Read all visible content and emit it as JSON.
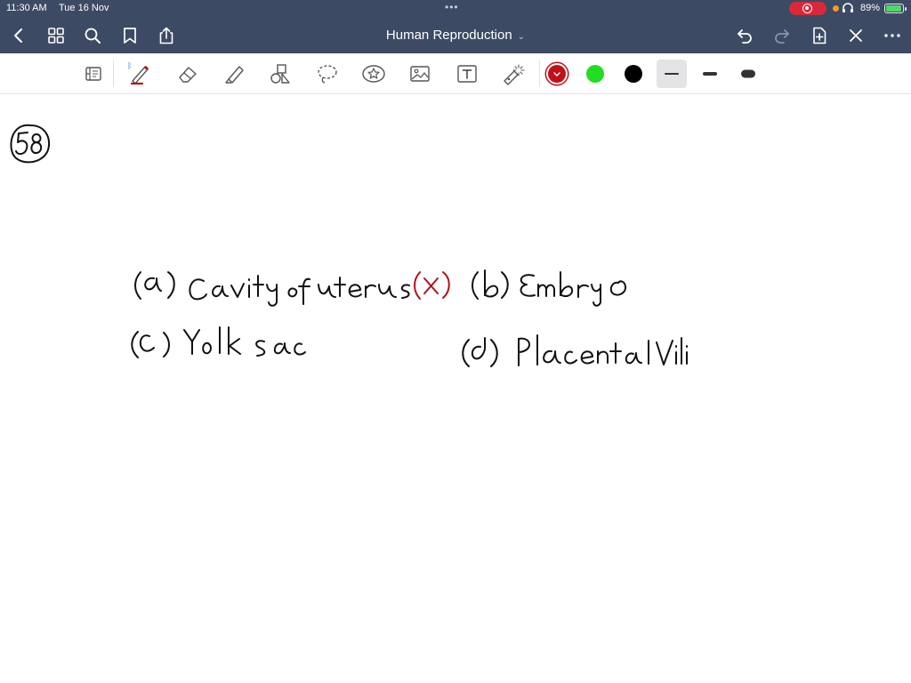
{
  "status_bar": {
    "time": "11:30 AM",
    "date": "Tue 16 Nov",
    "battery_percent": "89%"
  },
  "nav_bar": {
    "title": "Human Reproduction",
    "icons": [
      "back-icon",
      "grid-icon",
      "search-icon",
      "bookmark-icon",
      "share-icon",
      "undo-icon",
      "redo-icon",
      "add-page-icon",
      "close-icon",
      "more-icon"
    ]
  },
  "toolbar": {
    "tools": [
      "page-layout-icon",
      "pen-icon",
      "eraser-icon",
      "highlighter-icon",
      "shapes-icon",
      "lasso-icon",
      "sticker-icon",
      "image-icon",
      "text-icon",
      "laser-pointer-icon"
    ],
    "colors": {
      "red": "#c0101a",
      "green": "#22dd22",
      "black": "#000000"
    },
    "selected_width": "thin"
  },
  "note": {
    "question_number": "58",
    "option_a": "(a) Cavity of uterus(X)",
    "option_b": "(b) Embryo",
    "option_c": "(c) Yolk sac",
    "option_d": "(d) Placental villi"
  }
}
